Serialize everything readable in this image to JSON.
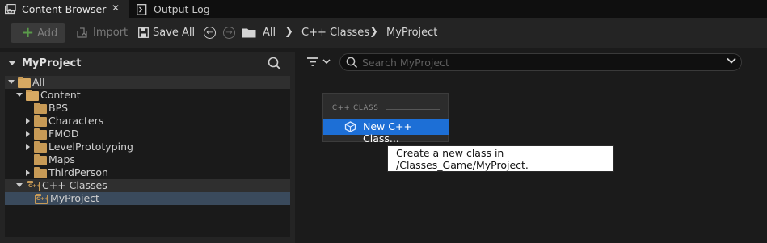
{
  "tabs": [
    {
      "label": "Content Browser",
      "icon": "content-browser-icon",
      "active": true
    },
    {
      "label": "Output Log",
      "icon": "output-log-icon",
      "active": false
    }
  ],
  "tab_close_glyph": "✕",
  "toolbar": {
    "add_label": "Add",
    "import_label": "Import",
    "save_all_label": "Save All",
    "breadcrumbs": [
      "All",
      "C++ Classes",
      "MyProject"
    ]
  },
  "sources_panel": {
    "title": "MyProject",
    "tree": [
      {
        "label": "All",
        "depth": 0,
        "expanded": true,
        "icon": "folder-open-icon"
      },
      {
        "label": "Content",
        "depth": 1,
        "expanded": true,
        "icon": "folder-open-icon"
      },
      {
        "label": "BPS",
        "depth": 2,
        "expanded": false,
        "icon": "folder-icon",
        "has_children": false
      },
      {
        "label": "Characters",
        "depth": 2,
        "expanded": false,
        "icon": "folder-icon",
        "has_children": true
      },
      {
        "label": "FMOD",
        "depth": 2,
        "expanded": false,
        "icon": "folder-icon",
        "has_children": true
      },
      {
        "label": "LevelPrototyping",
        "depth": 2,
        "expanded": false,
        "icon": "folder-icon",
        "has_children": true
      },
      {
        "label": "Maps",
        "depth": 2,
        "expanded": false,
        "icon": "folder-icon",
        "has_children": false
      },
      {
        "label": "ThirdPerson",
        "depth": 2,
        "expanded": false,
        "icon": "folder-icon",
        "has_children": true
      },
      {
        "label": "C++ Classes",
        "depth": 1,
        "expanded": true,
        "icon": "cpp-folder-icon"
      },
      {
        "label": "MyProject",
        "depth": 2,
        "expanded": false,
        "icon": "cpp-folder-icon",
        "selected": true
      }
    ]
  },
  "search": {
    "placeholder": "Search MyProject"
  },
  "context_menu": {
    "section_header": "C++ CLASS",
    "items": [
      {
        "label": "New C++ Class...",
        "icon": "cpp-class-icon",
        "highlighted": true
      }
    ]
  },
  "tooltip": {
    "text": "Create a new class in /Classes_Game/MyProject."
  },
  "colors": {
    "accent": "#1d6fd6",
    "folder": "#c79a56",
    "selected_row": "#3a4a5c",
    "add_plus": "#5a9a4a"
  }
}
